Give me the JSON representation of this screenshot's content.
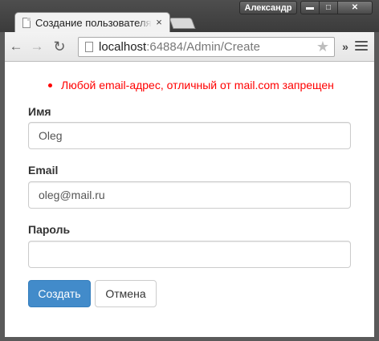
{
  "window": {
    "user_name": "Александр",
    "minimize_glyph": "▬",
    "maximize_glyph": "□",
    "close_glyph": "✕"
  },
  "tab": {
    "title": "Создание пользователя",
    "close_glyph": "×"
  },
  "toolbar": {
    "back_glyph": "←",
    "forward_glyph": "→",
    "reload_glyph": "↻",
    "url_host": "localhost",
    "url_rest": ":64884/Admin/Create",
    "star_glyph": "★",
    "more_glyph": "»",
    "icons": [
      "back-icon",
      "forward-icon",
      "reload-icon",
      "page-icon",
      "star-icon",
      "menu-icon"
    ]
  },
  "form": {
    "errors": [
      "Любой email-адрес, отличный от mail.com запрещен"
    ],
    "name_label": "Имя",
    "name_value": "Oleg",
    "email_label": "Email",
    "email_value": "oleg@mail.ru",
    "password_label": "Пароль",
    "password_value": "",
    "submit_label": "Создать",
    "cancel_label": "Отмена"
  },
  "colors": {
    "error": "#ff0000",
    "primary": "#428bca",
    "frame": "#5a5a5a"
  }
}
